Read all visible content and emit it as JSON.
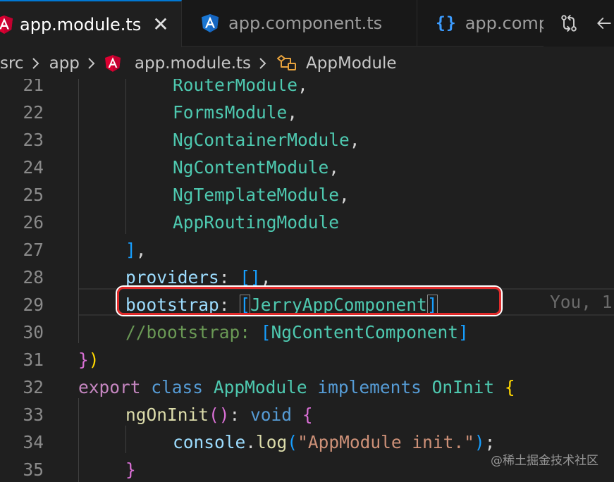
{
  "tabs": [
    {
      "label": "app.module.ts",
      "icon": "angular-red-icon",
      "active": true,
      "close": "✕"
    },
    {
      "label": "app.component.ts",
      "icon": "angular-blue-icon",
      "active": false
    },
    {
      "label": "app.compo",
      "icon": "braces-icon",
      "icon_text": "{}",
      "active": false
    }
  ],
  "tab_actions": [
    "source-control-compare-icon",
    "back-icon"
  ],
  "breadcrumb": {
    "items": [
      "src",
      "app",
      "app.module.ts",
      "AppModule"
    ]
  },
  "editor": {
    "lines": [
      {
        "n": "21",
        "tokens": [
          {
            "t": "        "
          },
          {
            "t": "RouterModule",
            "c": "t-class"
          },
          {
            "t": ","
          }
        ]
      },
      {
        "n": "22",
        "tokens": [
          {
            "t": "        "
          },
          {
            "t": "FormsModule",
            "c": "t-class"
          },
          {
            "t": ","
          }
        ]
      },
      {
        "n": "23",
        "tokens": [
          {
            "t": "        "
          },
          {
            "t": "NgContainerModule",
            "c": "t-class"
          },
          {
            "t": ","
          }
        ]
      },
      {
        "n": "24",
        "tokens": [
          {
            "t": "        "
          },
          {
            "t": "NgContentModule",
            "c": "t-class"
          },
          {
            "t": ","
          }
        ]
      },
      {
        "n": "25",
        "tokens": [
          {
            "t": "        "
          },
          {
            "t": "NgTemplateModule",
            "c": "t-class"
          },
          {
            "t": ","
          }
        ]
      },
      {
        "n": "26",
        "tokens": [
          {
            "t": "        "
          },
          {
            "t": "AppRoutingModule",
            "c": "t-class"
          }
        ]
      },
      {
        "n": "27",
        "tokens": [
          {
            "t": "    "
          },
          {
            "t": "]",
            "c": "t-b3"
          },
          {
            "t": ","
          }
        ]
      },
      {
        "n": "28",
        "tokens": [
          {
            "t": "    "
          },
          {
            "t": "providers",
            "c": "t-prop"
          },
          {
            "t": ": "
          },
          {
            "t": "[]",
            "c": "t-b3"
          },
          {
            "t": ","
          }
        ]
      },
      {
        "n": "29",
        "tokens": [
          {
            "t": "    "
          },
          {
            "t": "bootstrap",
            "c": "t-prop"
          },
          {
            "t": ": "
          },
          {
            "t": "[",
            "c": "t-b3",
            "box": true
          },
          {
            "t": "JerryAppComponent",
            "c": "t-class"
          },
          {
            "t": "]",
            "c": "t-b3",
            "box": true
          }
        ]
      },
      {
        "n": "30",
        "tokens": [
          {
            "t": "    "
          },
          {
            "t": "//bootstrap: ",
            "c": "t-com"
          },
          {
            "t": "[",
            "c": "t-b3"
          },
          {
            "t": "NgContentComponent",
            "c": "t-class"
          },
          {
            "t": "]",
            "c": "t-b3"
          }
        ]
      },
      {
        "n": "31",
        "tokens": [
          {
            "t": "}",
            "c": "t-b2"
          },
          {
            "t": ")",
            "c": "t-b1"
          }
        ]
      },
      {
        "n": "32",
        "tokens": [
          {
            "t": "export",
            "c": "t-kw"
          },
          {
            "t": " "
          },
          {
            "t": "class",
            "c": "t-kwb"
          },
          {
            "t": " "
          },
          {
            "t": "AppModule",
            "c": "t-class"
          },
          {
            "t": " "
          },
          {
            "t": "implements",
            "c": "t-kwb"
          },
          {
            "t": " "
          },
          {
            "t": "OnInit",
            "c": "t-class"
          },
          {
            "t": " "
          },
          {
            "t": "{",
            "c": "t-b1"
          }
        ]
      },
      {
        "n": "33",
        "tokens": [
          {
            "t": "    "
          },
          {
            "t": "ngOnInit",
            "c": "t-fn"
          },
          {
            "t": "()",
            "c": "t-b2"
          },
          {
            "t": ": "
          },
          {
            "t": "void",
            "c": "t-kwb"
          },
          {
            "t": " "
          },
          {
            "t": "{",
            "c": "t-b2"
          }
        ]
      },
      {
        "n": "34",
        "tokens": [
          {
            "t": "        "
          },
          {
            "t": "console",
            "c": "t-prop"
          },
          {
            "t": "."
          },
          {
            "t": "log",
            "c": "t-fn"
          },
          {
            "t": "(",
            "c": "t-b3"
          },
          {
            "t": "\"AppModule init.\"",
            "c": "t-str"
          },
          {
            "t": ")",
            "c": "t-b3"
          },
          {
            "t": ";"
          }
        ]
      },
      {
        "n": "35",
        "tokens": [
          {
            "t": "    "
          },
          {
            "t": "}",
            "c": "t-b2"
          }
        ]
      }
    ],
    "blame": "You, 1"
  },
  "watermark": "@稀土掘金技术社区",
  "colors": {
    "editor_bg": "#1f1f1f",
    "accent": "#0078d4",
    "highlight": "#e02b2b",
    "angular_red": "#dd0031",
    "angular_blue": "#1976d2"
  }
}
